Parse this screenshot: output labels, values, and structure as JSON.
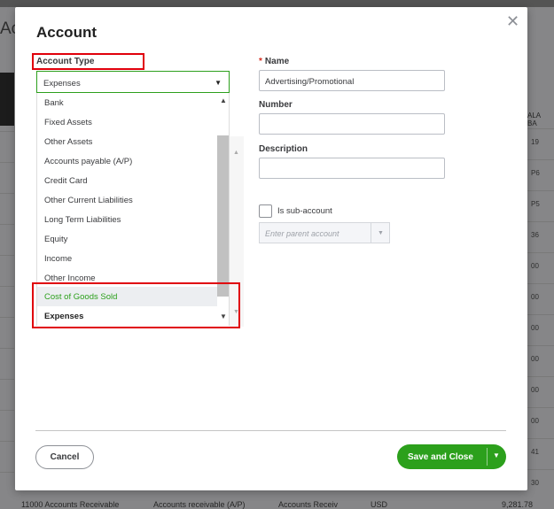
{
  "background": {
    "page_title_partial": "Ac",
    "col_header_partial": [
      "ALA",
      "BA"
    ],
    "row_values_partial": [
      "19",
      "P6",
      "P5",
      "36",
      "00",
      "00",
      "00",
      "00",
      "00",
      "00",
      "41",
      "30"
    ],
    "bottom_row": {
      "account": "11000 Accounts Receivable",
      "type": "Accounts receivable (A/P)",
      "detail": "Accounts Receiv",
      "currency": "USD",
      "balance": "9,281.78"
    }
  },
  "modal": {
    "title": "Account",
    "close_icon": "close-icon"
  },
  "account_type": {
    "label": "Account Type",
    "selected": "Expenses",
    "options": [
      "Bank",
      "Fixed Assets",
      "Other Assets",
      "Accounts payable (A/P)",
      "Credit Card",
      "Other Current Liabilities",
      "Long Term Liabilities",
      "Equity",
      "Income",
      "Other Income",
      "Cost of Goods Sold",
      "Expenses"
    ],
    "highlighted_option": "Cost of Goods Sold"
  },
  "name": {
    "required_marker": "*",
    "label": "Name",
    "value": "Advertising/Promotional"
  },
  "number": {
    "label": "Number",
    "value": ""
  },
  "description": {
    "label": "Description",
    "value": ""
  },
  "sub_account": {
    "label": "Is sub-account",
    "checked": false,
    "parent_placeholder": "Enter parent account"
  },
  "footer": {
    "cancel_label": "Cancel",
    "save_label": "Save and Close"
  },
  "colors": {
    "accent": "#2ca01c",
    "highlight_border": "#e0000b"
  }
}
